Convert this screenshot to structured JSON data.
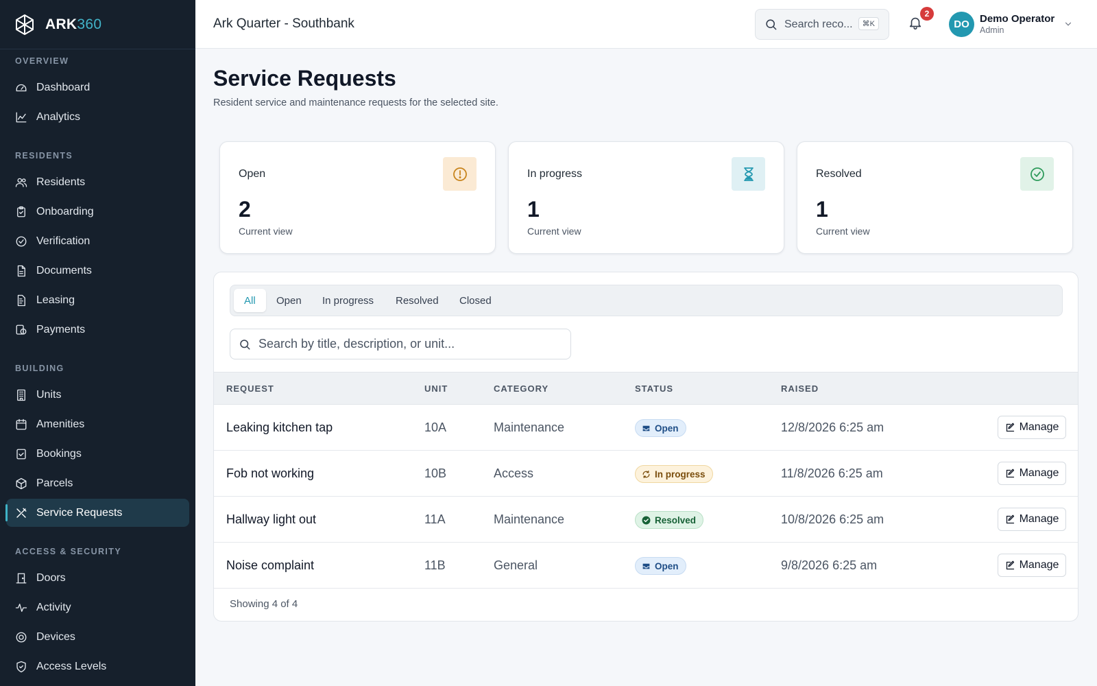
{
  "brand": {
    "name_bold": "ARK",
    "name_accent": "360"
  },
  "sidebar": {
    "groups": [
      {
        "title": "OVERVIEW",
        "items": [
          {
            "label": "Dashboard",
            "icon": "gauge-icon"
          },
          {
            "label": "Analytics",
            "icon": "line-chart-icon"
          }
        ]
      },
      {
        "title": "RESIDENTS",
        "items": [
          {
            "label": "Residents",
            "icon": "users-icon"
          },
          {
            "label": "Onboarding",
            "icon": "clipboard-icon"
          },
          {
            "label": "Verification",
            "icon": "check-circle-icon"
          },
          {
            "label": "Documents",
            "icon": "document-icon"
          },
          {
            "label": "Leasing",
            "icon": "file-text-icon"
          },
          {
            "label": "Payments",
            "icon": "payments-icon"
          }
        ]
      },
      {
        "title": "BUILDING",
        "items": [
          {
            "label": "Units",
            "icon": "building-icon"
          },
          {
            "label": "Amenities",
            "icon": "calendar-icon"
          },
          {
            "label": "Bookings",
            "icon": "calendar-check-icon"
          },
          {
            "label": "Parcels",
            "icon": "package-icon"
          },
          {
            "label": "Service Requests",
            "icon": "tools-icon",
            "active": true
          }
        ]
      },
      {
        "title": "ACCESS & SECURITY",
        "items": [
          {
            "label": "Doors",
            "icon": "door-icon"
          },
          {
            "label": "Activity",
            "icon": "activity-icon"
          },
          {
            "label": "Devices",
            "icon": "device-icon"
          },
          {
            "label": "Access Levels",
            "icon": "shield-icon"
          }
        ]
      }
    ]
  },
  "topbar": {
    "site_title": "Ark Quarter - Southbank",
    "search_placeholder": "Search reco...",
    "search_shortcut": "⌘K",
    "notification_count": "2",
    "user": {
      "initials": "DO",
      "name": "Demo Operator",
      "role": "Admin"
    }
  },
  "page": {
    "title": "Service Requests",
    "subtitle": "Resident service and maintenance requests for the selected site."
  },
  "stats": [
    {
      "label": "Open",
      "value": "2",
      "note": "Current view",
      "icon": "alert-circle-icon",
      "icon_bg": "#fbead4",
      "icon_color": "#c8841c"
    },
    {
      "label": "In progress",
      "value": "1",
      "note": "Current view",
      "icon": "hourglass-icon",
      "icon_bg": "#dff0f4",
      "icon_color": "#2398b0"
    },
    {
      "label": "Resolved",
      "value": "1",
      "note": "Current view",
      "icon": "check-circle-icon",
      "icon_bg": "#e1f2e8",
      "icon_color": "#2e9b5b"
    }
  ],
  "filters": {
    "tabs": [
      "All",
      "Open",
      "In progress",
      "Resolved",
      "Closed"
    ],
    "active_tab": "All",
    "search_placeholder": "Search by title, description, or unit..."
  },
  "table": {
    "columns": [
      "REQUEST",
      "UNIT",
      "CATEGORY",
      "STATUS",
      "RAISED"
    ],
    "rows": [
      {
        "request": "Leaking kitchen tap",
        "unit": "10A",
        "category": "Maintenance",
        "status": "Open",
        "status_kind": "open",
        "raised": "12/8/2026 6:25 am",
        "action": "Manage"
      },
      {
        "request": "Fob not working",
        "unit": "10B",
        "category": "Access",
        "status": "In progress",
        "status_kind": "progress",
        "raised": "11/8/2026 6:25 am",
        "action": "Manage"
      },
      {
        "request": "Hallway light out",
        "unit": "11A",
        "category": "Maintenance",
        "status": "Resolved",
        "status_kind": "resolved",
        "raised": "10/8/2026 6:25 am",
        "action": "Manage"
      },
      {
        "request": "Noise complaint",
        "unit": "11B",
        "category": "General",
        "status": "Open",
        "status_kind": "open",
        "raised": "9/8/2026 6:25 am",
        "action": "Manage"
      }
    ],
    "footer": "Showing 4 of 4"
  },
  "colors": {
    "sidebar_bg": "#16202c",
    "accent": "#2398b0",
    "active_nav_bg": "#1f3a4a",
    "badge_red": "#d63b3b"
  }
}
